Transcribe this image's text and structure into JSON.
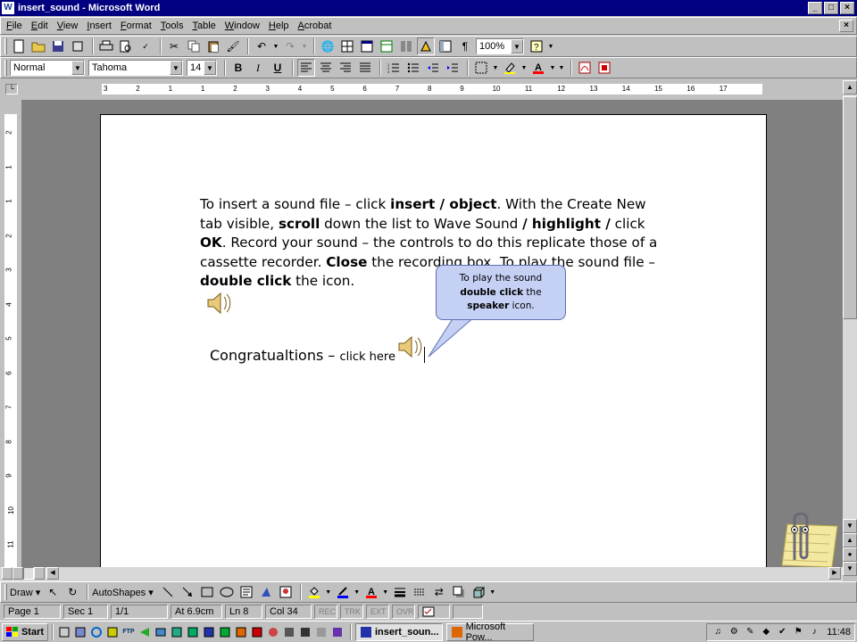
{
  "window": {
    "title": "insert_sound - Microsoft Word",
    "min_glyph": "_",
    "max_glyph": "□",
    "close_glyph": "×"
  },
  "menu": {
    "items": [
      "File",
      "Edit",
      "View",
      "Insert",
      "Format",
      "Tools",
      "Table",
      "Window",
      "Help",
      "Acrobat"
    ]
  },
  "standard_toolbar": {
    "zoom": "100%"
  },
  "formatting_toolbar": {
    "style": "Normal",
    "font": "Tahoma",
    "size": "14",
    "bold": "B",
    "italic": "I",
    "underline": "U"
  },
  "document": {
    "paragraph": [
      {
        "t": "To insert a sound file – click ",
        "b": false
      },
      {
        "t": "insert / object",
        "b": true
      },
      {
        "t": ". With the Create New tab visible, ",
        "b": false
      },
      {
        "t": "scroll",
        "b": true
      },
      {
        "t": " down the list to Wave Sound ",
        "b": false
      },
      {
        "t": "/ highlight /",
        "b": true
      },
      {
        "t": " click ",
        "b": false
      },
      {
        "t": "OK",
        "b": true
      },
      {
        "t": ". Record your sound – the controls to do this replicate those of a cassette recorder. ",
        "b": false
      },
      {
        "t": "Close",
        "b": true
      },
      {
        "t": " the recording box. To play the sound file – ",
        "b": false
      },
      {
        "t": "double click",
        "b": true
      },
      {
        "t": " the icon.",
        "b": false
      }
    ],
    "congrats_main": "Congratualtions – ",
    "congrats_link": "click here",
    "callout": {
      "line1": "To play the sound",
      "line2_bold": "double click",
      "line2_rest": " the",
      "line3_bold": "speaker",
      "line3_rest": " icon."
    }
  },
  "drawing_toolbar": {
    "draw": "Draw",
    "autoshapes": "AutoShapes"
  },
  "status": {
    "page": "Page 1",
    "sec": "Sec 1",
    "pages": "1/1",
    "at": "At 6.9cm",
    "ln": "Ln 8",
    "col": "Col 34",
    "rec": "REC",
    "trk": "TRK",
    "ext": "EXT",
    "ovr": "OVR"
  },
  "taskbar": {
    "start": "Start",
    "tasks": [
      "insert_soun...",
      "Microsoft Pow..."
    ],
    "clock": "11:48"
  },
  "ruler": {
    "h_numbers": [
      "3",
      "2",
      "1",
      "1",
      "2",
      "3",
      "4",
      "5",
      "6",
      "7",
      "8",
      "9",
      "10",
      "11",
      "12",
      "13",
      "14",
      "15",
      "16",
      "17"
    ],
    "v_numbers": [
      "2",
      "1",
      "1",
      "2",
      "3",
      "4",
      "5",
      "6",
      "7",
      "8",
      "9",
      "10",
      "11"
    ]
  }
}
